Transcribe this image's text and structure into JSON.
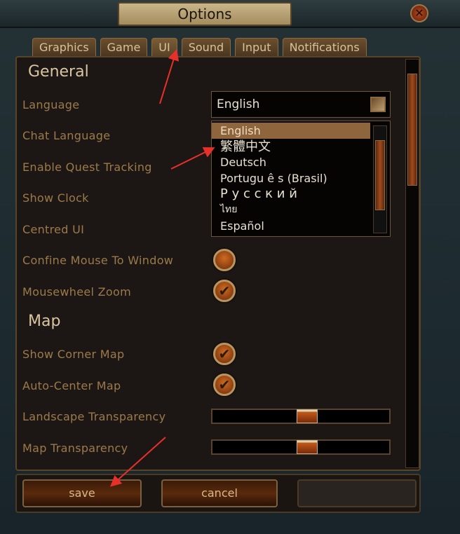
{
  "window": {
    "title": "Options",
    "close_icon": "close-x-icon"
  },
  "tabs": [
    {
      "label": "Graphics"
    },
    {
      "label": "Game"
    },
    {
      "label": "UI",
      "active": true
    },
    {
      "label": "Sound"
    },
    {
      "label": "Input"
    },
    {
      "label": "Notifications"
    }
  ],
  "general": {
    "heading": "General",
    "language_label": "Language",
    "language_value": "English",
    "chat_language_label": "Chat Language",
    "quest_tracking_label": "Enable Quest Tracking",
    "show_clock_label": "Show Clock",
    "centred_ui_label": "Centred UI",
    "confine_mouse_label": "Confine Mouse To Window",
    "confine_mouse_checked": false,
    "mousewheel_zoom_label": "Mousewheel Zoom",
    "mousewheel_zoom_checked": true
  },
  "language_options": [
    "English",
    "繁體中文",
    "Deutsch",
    "Portugu ê s (Brasil)",
    "Ｐｙсский",
    "ไทย",
    "Español"
  ],
  "language_options_display": [
    "English",
    "繁體中文",
    "Deutsch",
    "Portugu ê s (Brasil)",
    "Р у с с к и й",
    "ไทย",
    "Español"
  ],
  "map": {
    "heading": "Map",
    "show_corner_map_label": "Show Corner Map",
    "show_corner_map_checked": true,
    "auto_center_label": "Auto-Center Map",
    "auto_center_checked": true,
    "landscape_transparency_label": "Landscape Transparency",
    "landscape_transparency_value": 0.5,
    "map_transparency_label": "Map Transparency",
    "map_transparency_value": 0.5
  },
  "footer": {
    "save_label": "save",
    "cancel_label": "cancel"
  },
  "colors": {
    "accent": "#8e653c",
    "annotation_arrow": "#e8302a"
  }
}
